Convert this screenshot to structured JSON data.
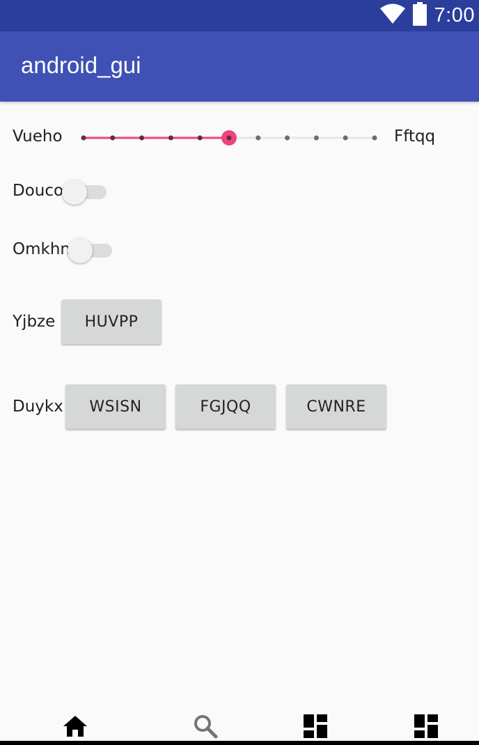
{
  "status_bar": {
    "time": "7:00",
    "icons": [
      "wifi-icon",
      "battery-icon"
    ]
  },
  "app_bar": {
    "title": "android_gui"
  },
  "seekbar_row": {
    "label": "Vueho",
    "end_label": "Fftqq",
    "progress_step": 5,
    "total_steps": 10,
    "accent_color": "#f0437b"
  },
  "switches": [
    {
      "label": "Douco",
      "checked": false
    },
    {
      "label": "Omkhn",
      "checked": false
    }
  ],
  "button_rows": [
    {
      "label": "Yjbze",
      "buttons": [
        "HUVPP"
      ]
    },
    {
      "label": "Duykx",
      "buttons": [
        "WSISN",
        "FGJQQ",
        "CWNRE"
      ]
    }
  ],
  "bottom_nav": {
    "items": [
      "home-icon",
      "search-icon",
      "dashboard-icon",
      "dashboard-icon"
    ]
  },
  "colors": {
    "status_bar": "#2c3e9c",
    "app_bar": "#3f51b5",
    "background": "#fafafa",
    "button": "#d6d7d7"
  }
}
